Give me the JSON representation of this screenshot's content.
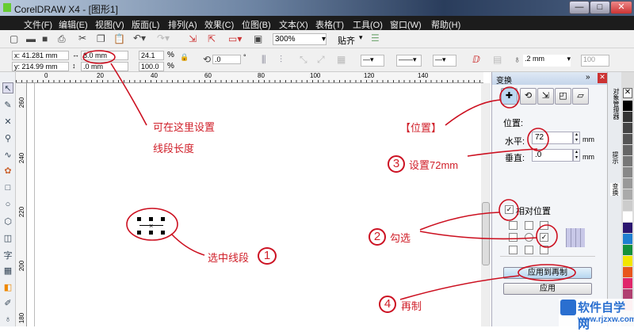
{
  "window": {
    "title": "CorelDRAW X4 - [图形1]",
    "min": "—",
    "max": "□",
    "close": "✕"
  },
  "menu": [
    "文件(F)",
    "编辑(E)",
    "视图(V)",
    "版面(L)",
    "排列(A)",
    "效果(C)",
    "位图(B)",
    "文本(X)",
    "表格(T)",
    "工具(O)",
    "窗口(W)",
    "帮助(H)"
  ],
  "toolbar": {
    "zoom": "300%",
    "snap": "贴齐"
  },
  "property_bar": {
    "x": "x: 41.281 mm",
    "y": "y: 214.99 mm",
    "width": "8.0 mm",
    "height": ".0 mm",
    "scale_x": "24.1",
    "scale_y": "100.0",
    "pct": "%",
    "angle": ".0",
    "deg": "°",
    "outline": ".2 mm",
    "opacity": "100"
  },
  "rulers": {
    "h": [
      "0",
      "20",
      "40",
      "60",
      "80",
      "100",
      "120",
      "140"
    ],
    "v": [
      "260",
      "240",
      "220",
      "200",
      "180"
    ]
  },
  "docker": {
    "title": "变换",
    "section": "位置:",
    "h_label": "水平:",
    "h_value": "72",
    "v_label": "垂直:",
    "v_value": ".0",
    "unit": "mm",
    "relative": "相对位置",
    "apply_dup": "应用到再制",
    "apply": "应用",
    "side_tabs": [
      "对象管理器",
      "提示",
      "变换"
    ]
  },
  "palette": [
    "#000000",
    "#333333",
    "#444444",
    "#555555",
    "#666666",
    "#777777",
    "#888888",
    "#999999",
    "#aaaaaa",
    "#cccccc",
    "#ffffff",
    "#2b1670",
    "#1f7fd0",
    "#15903a",
    "#f2e600",
    "#e8561c",
    "#e0266a",
    "#b04070",
    "#f0a0b0"
  ],
  "annotations": {
    "a1": "可在这里设置",
    "a2": "线段长度",
    "pos": "【位置】",
    "n3": "3",
    "s3": "设置72mm",
    "n2": "2",
    "s2": "勾选",
    "n1": "1",
    "s1": "选中线段",
    "n4": "4",
    "s4": "再制"
  },
  "watermark": {
    "name": "软件自学网",
    "url": "www.rjzxw.com"
  }
}
